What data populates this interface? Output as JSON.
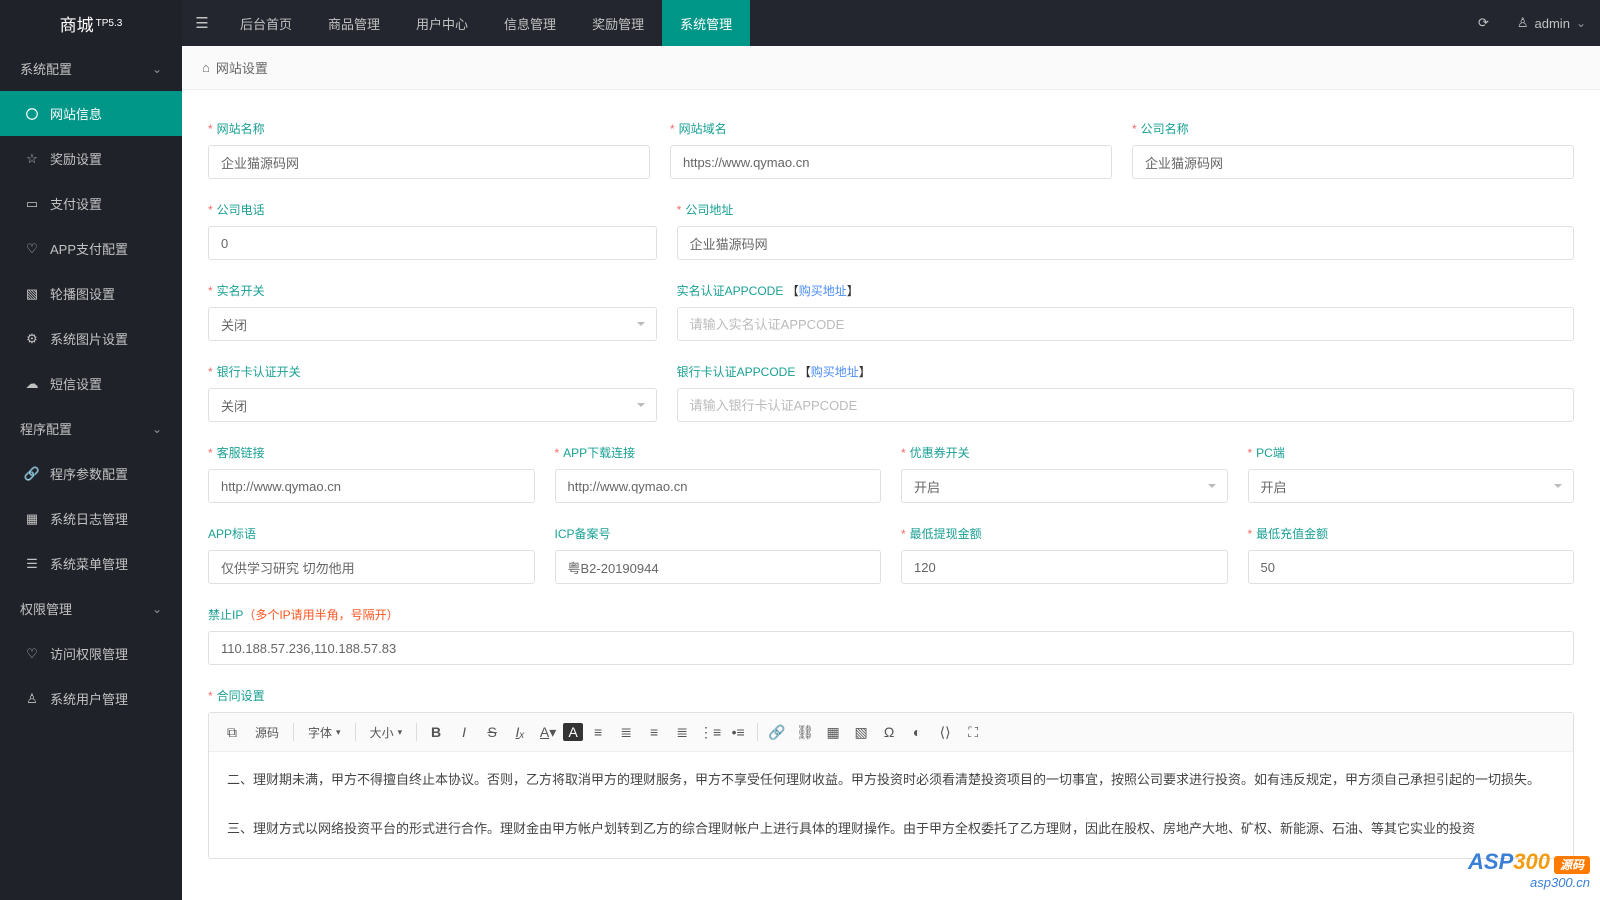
{
  "logo": {
    "name": "商城",
    "sup": "TP5.3"
  },
  "topnav": [
    "后台首页",
    "商品管理",
    "用户中心",
    "信息管理",
    "奖励管理",
    "系统管理"
  ],
  "user": "admin",
  "breadcrumb": "网站设置",
  "sidebar": {
    "g1": "系统配置",
    "items1": [
      "网站信息",
      "奖励设置",
      "支付设置",
      "APP支付配置",
      "轮播图设置",
      "系统图片设置",
      "短信设置"
    ],
    "g2": "程序配置",
    "items2": [
      "程序参数配置",
      "系统日志管理",
      "系统菜单管理"
    ],
    "g3": "权限管理",
    "items3": [
      "访问权限管理",
      "系统用户管理"
    ]
  },
  "form": {
    "site_name": {
      "label": "网站名称",
      "value": "企业猫源码网"
    },
    "site_domain": {
      "label": "网站域名",
      "value": "https://www.qymao.cn"
    },
    "company_name": {
      "label": "公司名称",
      "value": "企业猫源码网"
    },
    "company_phone": {
      "label": "公司电话",
      "value": "0"
    },
    "company_addr": {
      "label": "公司地址",
      "value": "企业猫源码网"
    },
    "realname_switch": {
      "label": "实名开关",
      "value": "关闭"
    },
    "realname_code": {
      "label": "实名认证APPCODE",
      "link": "购买地址",
      "placeholder": "请输入实名认证APPCODE"
    },
    "bankcard_switch": {
      "label": "银行卡认证开关",
      "value": "关闭"
    },
    "bankcard_code": {
      "label": "银行卡认证APPCODE",
      "link": "购买地址",
      "placeholder": "请输入银行卡认证APPCODE"
    },
    "service_link": {
      "label": "客服链接",
      "value": "http://www.qymao.cn"
    },
    "app_download": {
      "label": "APP下载连接",
      "value": "http://www.qymao.cn"
    },
    "coupon_switch": {
      "label": "优惠券开关",
      "value": "开启"
    },
    "pc_switch": {
      "label": "PC端",
      "value": "开启"
    },
    "app_slogan": {
      "label": "APP标语",
      "value": "仅供学习研究 切勿他用"
    },
    "icp": {
      "label": "ICP备案号",
      "value": "粤B2-20190944"
    },
    "min_withdraw": {
      "label": "最低提现金额",
      "value": "120"
    },
    "min_recharge": {
      "label": "最低充值金额",
      "value": "50"
    },
    "ban_ip": {
      "label": "禁止IP",
      "hint": "（多个IP请用半角，号隔开）",
      "value": "110.188.57.236,110.188.57.83"
    },
    "contract": {
      "label": "合同设置"
    }
  },
  "editor": {
    "source": "源码",
    "font": "字体",
    "size": "大小",
    "p1": "二、理财期未满，甲方不得擅自终止本协议。否则，乙方将取消甲方的理财服务，甲方不享受任何理财收益。甲方投资时必须看清楚投资项目的一切事宜，按照公司要求进行投资。如有违反规定，甲方须自己承担引起的一切损失。",
    "p2": "三、理财方式以网络投资平台的形式进行合作。理财金由甲方帐户划转到乙方的综合理财帐户上进行具体的理财操作。由于甲方全权委托了乙方理财，因此在股权、房地产大地、矿权、新能源、石油、等其它实业的投资"
  },
  "watermark": {
    "a": "ASP",
    "b": "300",
    "tag": "源码",
    "url": "asp300.cn"
  }
}
